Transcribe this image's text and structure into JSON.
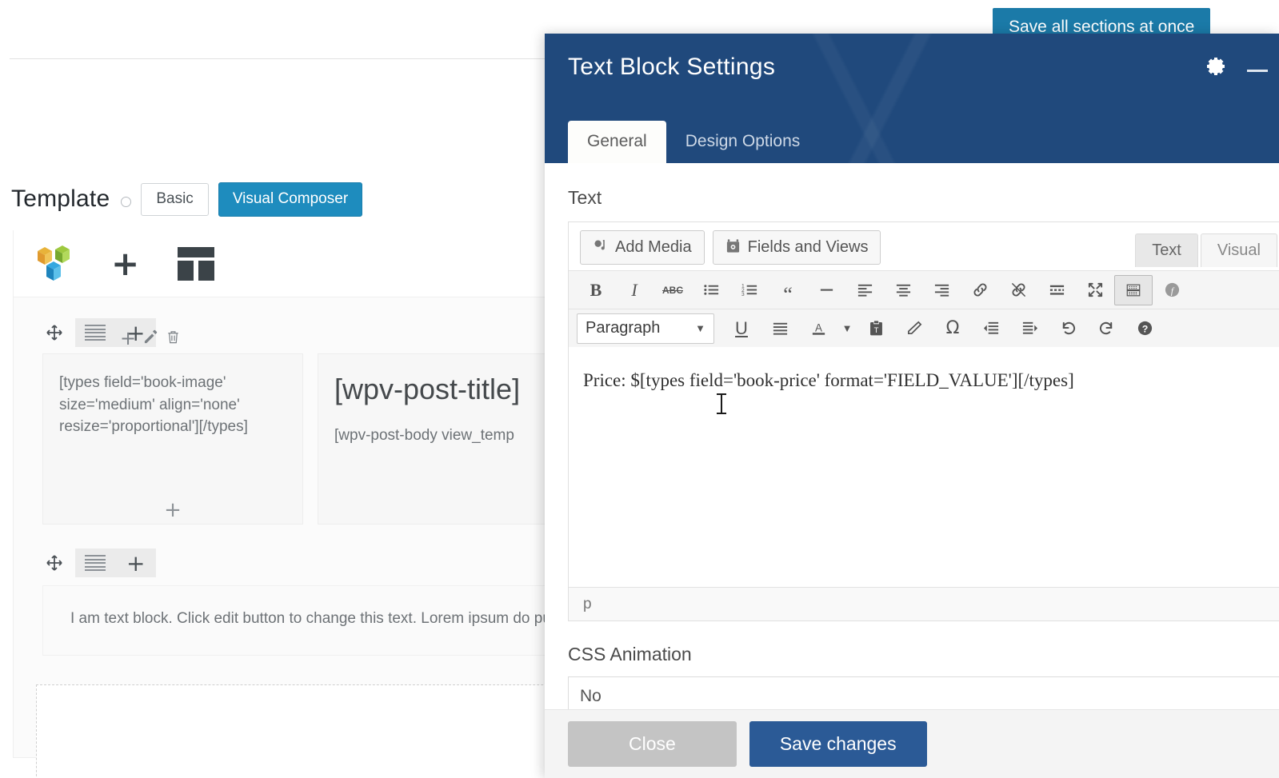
{
  "background": {
    "template": {
      "label": "Template",
      "help_icon": "help-icon",
      "basic_label": "Basic",
      "visual_composer_label": "Visual Composer",
      "active": "Visual Composer"
    },
    "vc_toolbar": {
      "logo_icon": "visual-composer-logo",
      "add_element_icon": "plus-icon",
      "templates_icon": "layout-grid-icon"
    },
    "row1": {
      "drag_icon": "move-handle-icon",
      "row_settings_icon": "row-settings-icon",
      "add_icon": "plus-icon",
      "element_actions": [
        "plus-icon",
        "pencil-icon",
        "trash-icon"
      ],
      "col1_shortcode": "[types field='book-image' size='medium' align='none' resize='proportional'][/types]",
      "col1_add_icon": "plus-icon",
      "col2_title_shortcode": "[wpv-post-title]",
      "col2_body_shortcode": "[wpv-post-body view_temp"
    },
    "row2": {
      "drag_icon": "move-handle-icon",
      "row_settings_icon": "row-settings-icon",
      "add_icon": "plus-icon",
      "text": "I am text block. Click edit button to change this text. Lorem ipsum do pulvinar dapibus leo."
    },
    "save_all_button": "Save all sections at once"
  },
  "modal": {
    "title": "Text Block Settings",
    "gear_icon": "gear-icon",
    "minimize_icon": "minimize-icon",
    "tabs": [
      {
        "label": "General",
        "active": true
      },
      {
        "label": "Design Options",
        "active": false
      }
    ],
    "text_field": {
      "label": "Text",
      "add_media_label": "Add Media",
      "add_media_icon": "add-media-icon",
      "fields_and_views_label": "Fields and Views",
      "fields_and_views_icon": "fields-views-icon",
      "editor_tabs": [
        {
          "label": "Text",
          "active": true
        },
        {
          "label": "Visual",
          "active": false
        }
      ],
      "toolbar_row1": [
        {
          "name": "bold-icon",
          "glyph": "B"
        },
        {
          "name": "italic-icon",
          "glyph": "I"
        },
        {
          "name": "strikethrough-icon",
          "glyph": "ABC"
        },
        {
          "name": "bulleted-list-icon",
          "glyph": ""
        },
        {
          "name": "numbered-list-icon",
          "glyph": ""
        },
        {
          "name": "blockquote-icon",
          "glyph": "“"
        },
        {
          "name": "horizontal-rule-icon",
          "glyph": "—"
        },
        {
          "name": "align-left-icon",
          "glyph": ""
        },
        {
          "name": "align-center-icon",
          "glyph": ""
        },
        {
          "name": "align-right-icon",
          "glyph": ""
        },
        {
          "name": "insert-link-icon",
          "glyph": ""
        },
        {
          "name": "unlink-icon",
          "glyph": ""
        },
        {
          "name": "read-more-icon",
          "glyph": ""
        },
        {
          "name": "fullscreen-icon",
          "glyph": ""
        },
        {
          "name": "toggle-toolbar-icon",
          "glyph": ""
        },
        {
          "name": "formatting-icon",
          "glyph": ""
        }
      ],
      "paragraph_select": "Paragraph",
      "toolbar_row2": [
        {
          "name": "underline-icon",
          "glyph": "U"
        },
        {
          "name": "justify-icon",
          "glyph": ""
        },
        {
          "name": "text-color-icon",
          "glyph": "A"
        },
        {
          "name": "paste-as-text-icon",
          "glyph": ""
        },
        {
          "name": "clear-formatting-icon",
          "glyph": ""
        },
        {
          "name": "special-character-icon",
          "glyph": "Ω"
        },
        {
          "name": "outdent-icon",
          "glyph": ""
        },
        {
          "name": "indent-icon",
          "glyph": ""
        },
        {
          "name": "undo-icon",
          "glyph": ""
        },
        {
          "name": "redo-icon",
          "glyph": ""
        },
        {
          "name": "keyboard-shortcuts-icon",
          "glyph": "?"
        }
      ],
      "content": "Price: $[types field='book-price' format='FIELD_VALUE'][/types]",
      "status_path": "p"
    },
    "css_animation": {
      "label": "CSS Animation",
      "value": "No"
    },
    "footer": {
      "close_label": "Close",
      "save_label": "Save changes"
    }
  },
  "colors": {
    "modal_header": "#20497c",
    "save_all": "#1b7aa8",
    "vc_button": "#1e8cbe",
    "save_changes": "#2b5a96",
    "close_button": "#c4c4c4"
  }
}
